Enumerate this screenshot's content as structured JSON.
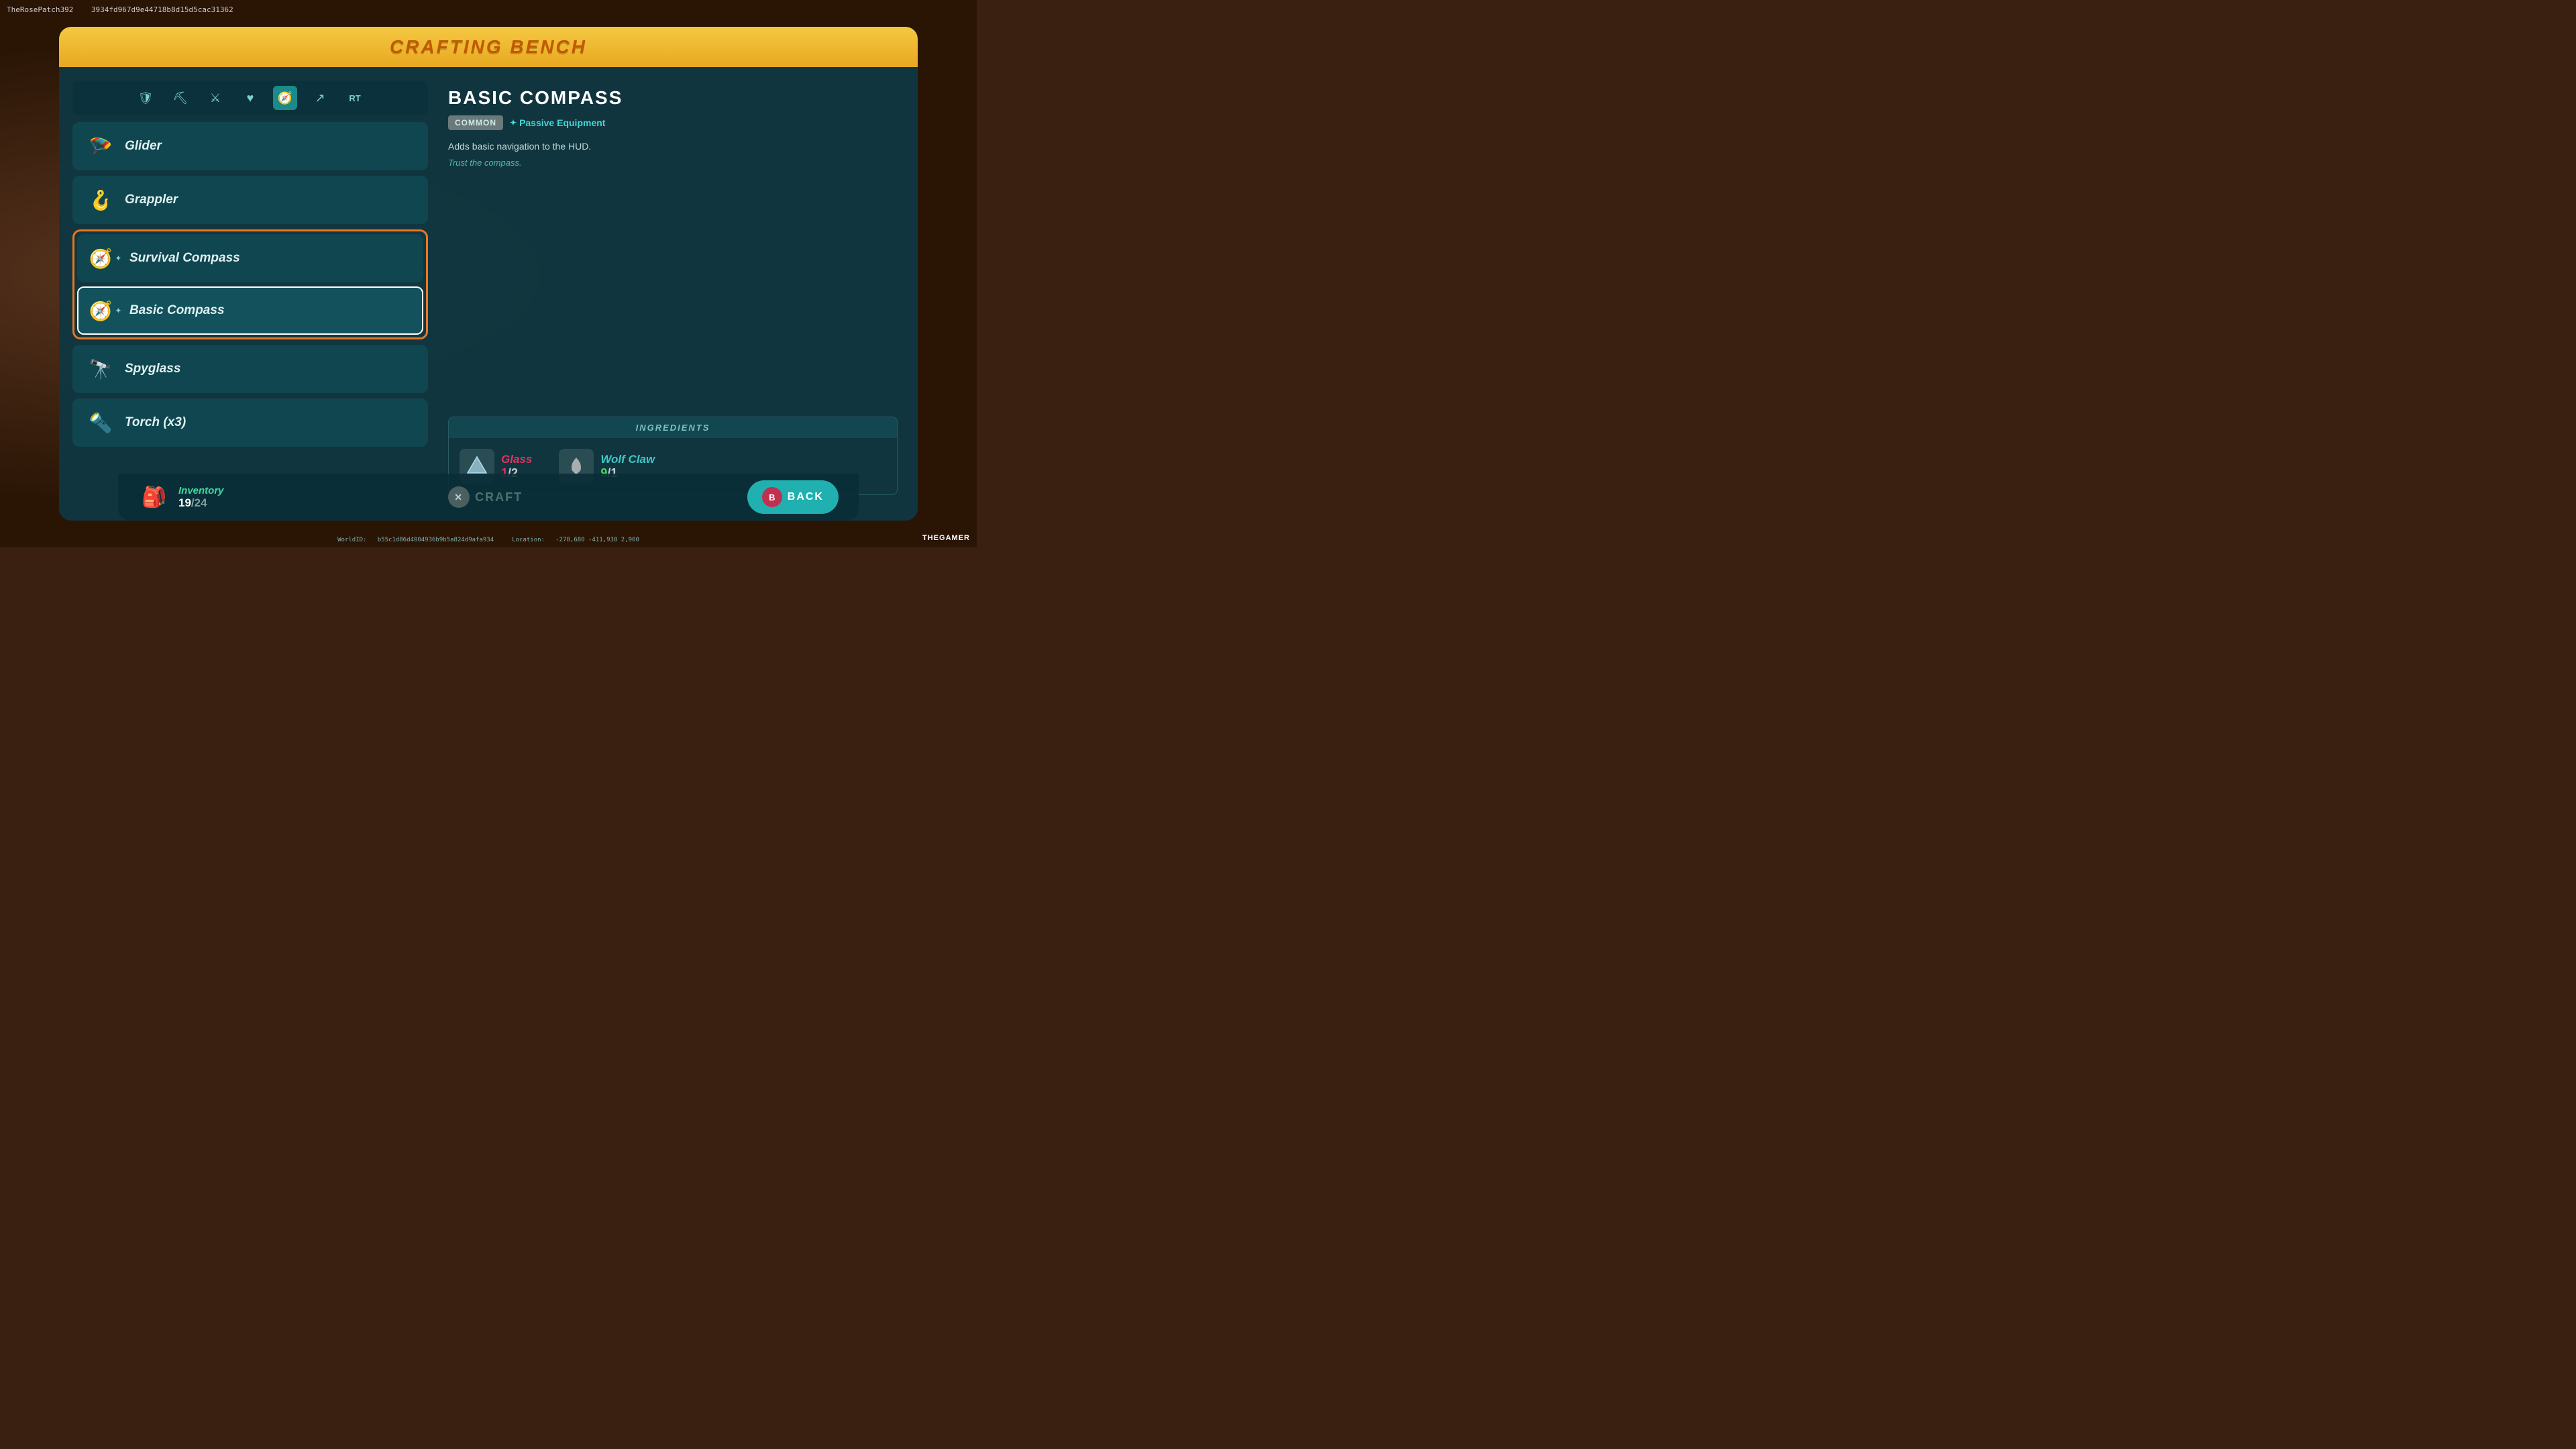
{
  "user": {
    "name": "TheRosePatch392",
    "id": "3934fd967d9e44718b8d15d5cac31362"
  },
  "title": "CRAFTING BENCH",
  "tabs": [
    {
      "id": "shield",
      "icon": "🛡",
      "active": false
    },
    {
      "id": "pickaxe",
      "icon": "⛏",
      "active": false
    },
    {
      "id": "sword",
      "icon": "⚔",
      "active": false
    },
    {
      "id": "heart",
      "icon": "♥",
      "active": false
    },
    {
      "id": "compass",
      "icon": "🧭",
      "active": true
    },
    {
      "id": "arrow",
      "icon": "↗",
      "active": false
    },
    {
      "id": "rt",
      "icon": "RT",
      "active": false
    }
  ],
  "items": [
    {
      "id": "glider",
      "name": "Glider",
      "icon": "🪂",
      "selected": false,
      "grouped": false
    },
    {
      "id": "grappler",
      "name": "Grappler",
      "icon": "🔩",
      "selected": false,
      "grouped": false
    },
    {
      "id": "survival-compass",
      "name": "Survival Compass",
      "icon": "🧭",
      "selected": false,
      "grouped": true
    },
    {
      "id": "basic-compass",
      "name": "Basic Compass",
      "icon": "🧭",
      "selected": true,
      "grouped": true
    },
    {
      "id": "spyglass",
      "name": "Spyglass",
      "icon": "🔭",
      "selected": false,
      "grouped": false
    },
    {
      "id": "torch",
      "name": "Torch (x3)",
      "icon": "🔦",
      "selected": false,
      "grouped": false
    }
  ],
  "detail": {
    "title": "BASIC COMPASS",
    "rarity": "COMMON",
    "type": "Passive Equipment",
    "description": "Adds basic navigation to the HUD.",
    "flavor": "Trust the compass."
  },
  "ingredients": {
    "header": "INGREDIENTS",
    "items": [
      {
        "id": "glass",
        "name": "Glass",
        "icon": "💎",
        "have": 1,
        "need": 2,
        "enough": false
      },
      {
        "id": "wolf-claw",
        "name": "Wolf Claw",
        "icon": "🦴",
        "have": 9,
        "need": 1,
        "enough": true
      }
    ]
  },
  "inventory": {
    "label": "Inventory",
    "current": 19,
    "max": 24,
    "icon": "🎒"
  },
  "buttons": {
    "craft": "CRAFT",
    "craft_prefix": "✕",
    "back": "BACK",
    "back_prefix": "B"
  },
  "footer": {
    "world_id_label": "WorldID:",
    "world_id": "b55c1d86d4004936b9b5a824d9afa934",
    "location_label": "Location:",
    "location": "-278,680  -411,938  2,900"
  },
  "watermark": "THEGAMER"
}
